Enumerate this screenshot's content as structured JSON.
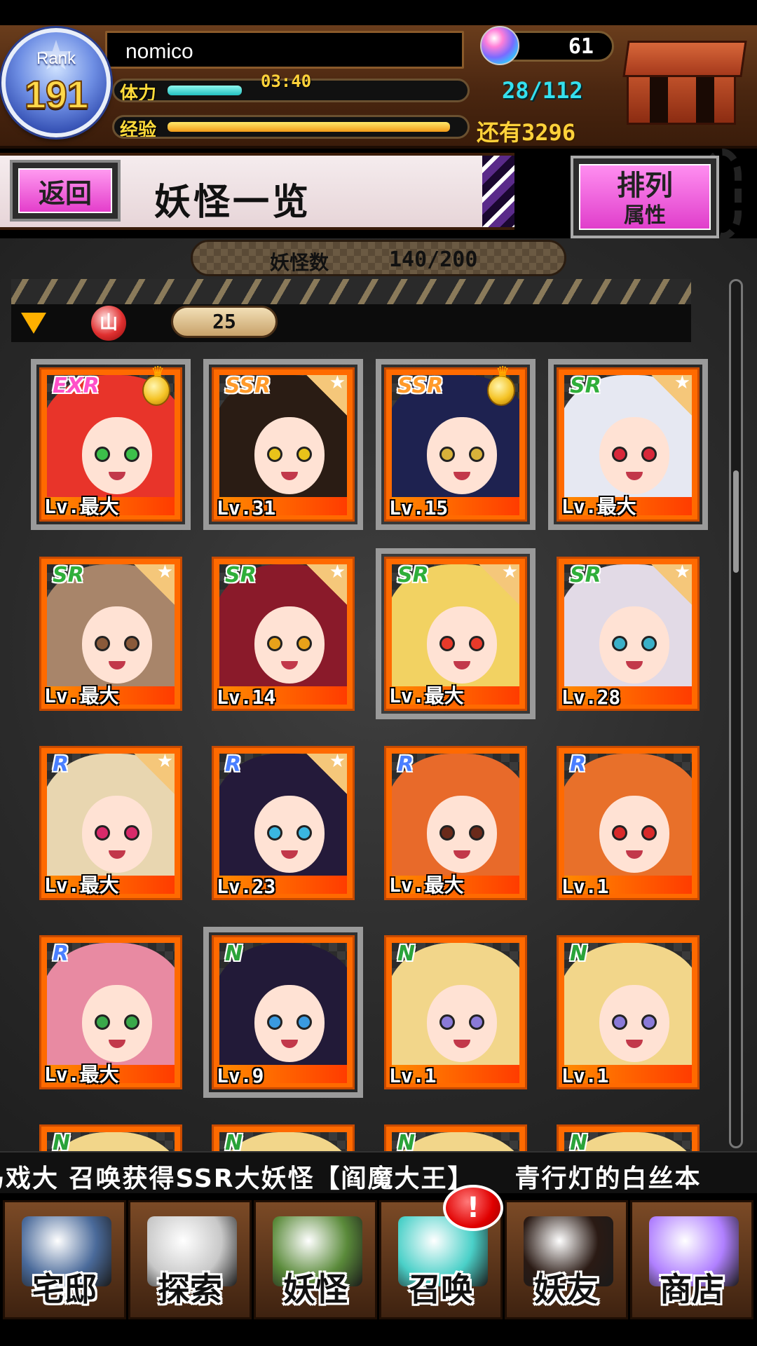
{
  "header": {
    "rank_label": "Rank",
    "rank": "191",
    "player_name": "nomico",
    "stamina_label": "体力",
    "stamina_timer": "03:40",
    "stamina_value": "28/112",
    "stamina_fraction": 0.25,
    "exp_label": "经验",
    "exp_remaining_label": "还有",
    "exp_remaining": "3296",
    "exp_fraction": 0.95,
    "gems": "61"
  },
  "titlebar": {
    "back_label": "返回",
    "title": "妖怪一览",
    "sort_label": "排列",
    "sort_value": "属性"
  },
  "count": {
    "label": "妖怪数",
    "value": "140/200"
  },
  "filter": {
    "element_glyph": "山",
    "level": "25"
  },
  "cards": [
    {
      "rarity": "EXR",
      "level": "Lv.最大",
      "medal": true,
      "hair": "#e8342a",
      "eye": "#3cbf4a",
      "selected": true
    },
    {
      "rarity": "SSR",
      "level": "Lv.31",
      "medal": false,
      "hair": "#2a1c14",
      "eye": "#e8c21a",
      "selected": true
    },
    {
      "rarity": "SSR",
      "level": "Lv.15",
      "medal": true,
      "hair": "#1e2250",
      "eye": "#d8b23a",
      "selected": true
    },
    {
      "rarity": "SR",
      "level": "Lv.最大",
      "medal": false,
      "hair": "#e6e8f2",
      "eye": "#d8283a",
      "selected": true
    },
    {
      "rarity": "SR",
      "level": "Lv.最大",
      "medal": false,
      "hair": "#a8856a",
      "eye": "#8a5a3a",
      "selected": false
    },
    {
      "rarity": "SR",
      "level": "Lv.14",
      "medal": false,
      "hair": "#8a1a2a",
      "eye": "#e8a21a",
      "selected": false
    },
    {
      "rarity": "SR",
      "level": "Lv.最大",
      "medal": false,
      "hair": "#f2d262",
      "eye": "#e83a2a",
      "selected": true
    },
    {
      "rarity": "SR",
      "level": "Lv.28",
      "medal": false,
      "hair": "#e2dae6",
      "eye": "#3ab0c8",
      "selected": false
    },
    {
      "rarity": "R",
      "level": "Lv.最大",
      "medal": false,
      "hair": "#e8d6b0",
      "eye": "#d82a6a",
      "selected": false
    },
    {
      "rarity": "R",
      "level": "Lv.23",
      "medal": false,
      "hair": "#241a3a",
      "eye": "#3ab6e0",
      "selected": false
    },
    {
      "rarity": "R",
      "level": "Lv.最大",
      "medal": false,
      "hair": "#e86a2a",
      "eye": "#6a2a1a",
      "selected": false
    },
    {
      "rarity": "R",
      "level": "Lv.1",
      "medal": false,
      "hair": "#e8702a",
      "eye": "#d82a2a",
      "selected": false
    },
    {
      "rarity": "R",
      "level": "Lv.最大",
      "medal": false,
      "hair": "#e88aa2",
      "eye": "#3aa84a",
      "selected": false
    },
    {
      "rarity": "N",
      "level": "Lv.9",
      "medal": false,
      "hair": "#221a38",
      "eye": "#3a9ae0",
      "selected": true
    },
    {
      "rarity": "N",
      "level": "Lv.1",
      "medal": false,
      "hair": "#f2d68a",
      "eye": "#8a7ad8",
      "selected": false
    },
    {
      "rarity": "N",
      "level": "Lv.1",
      "medal": false,
      "hair": "#f2d68a",
      "eye": "#8a7ad8",
      "selected": false
    },
    {
      "rarity": "N",
      "level": "",
      "medal": false,
      "hair": "#f2d68a",
      "eye": "#8a7ad8",
      "selected": false
    },
    {
      "rarity": "N",
      "level": "",
      "medal": false,
      "hair": "#f2d68a",
      "eye": "#8a7ad8",
      "selected": false
    },
    {
      "rarity": "N",
      "level": "",
      "medal": false,
      "hair": "#f2d68a",
      "eye": "#8a7ad8",
      "selected": false
    },
    {
      "rarity": "N",
      "level": "",
      "medal": false,
      "hair": "#f2d68a",
      "eye": "#8a7ad8",
      "selected": false
    }
  ],
  "ticker": "马戏大 召唤获得SSR大妖怪【阎魔大王】　　青行灯的白丝本",
  "nav": [
    {
      "label": "宅邸",
      "icon": "mansion-icon",
      "color": "#4a6a9a"
    },
    {
      "label": "探索",
      "icon": "magnifier-icon",
      "color": "#c8c8c8"
    },
    {
      "label": "妖怪",
      "icon": "scroll-icon",
      "color": "#5a8a3a"
    },
    {
      "label": "召唤",
      "icon": "pentagram-icon",
      "color": "#4ad0c8"
    },
    {
      "label": "妖友",
      "icon": "friend-icon",
      "color": "#2a1a14"
    },
    {
      "label": "商店",
      "icon": "orb-icon",
      "color": "#b080ff"
    }
  ],
  "nav_badge": "!",
  "colors": {
    "accent_pink": "#e43ecb",
    "card_orange": "#ff6a00",
    "stamina_cyan": "#35e0ee",
    "exp_gold": "#ffd23a"
  }
}
